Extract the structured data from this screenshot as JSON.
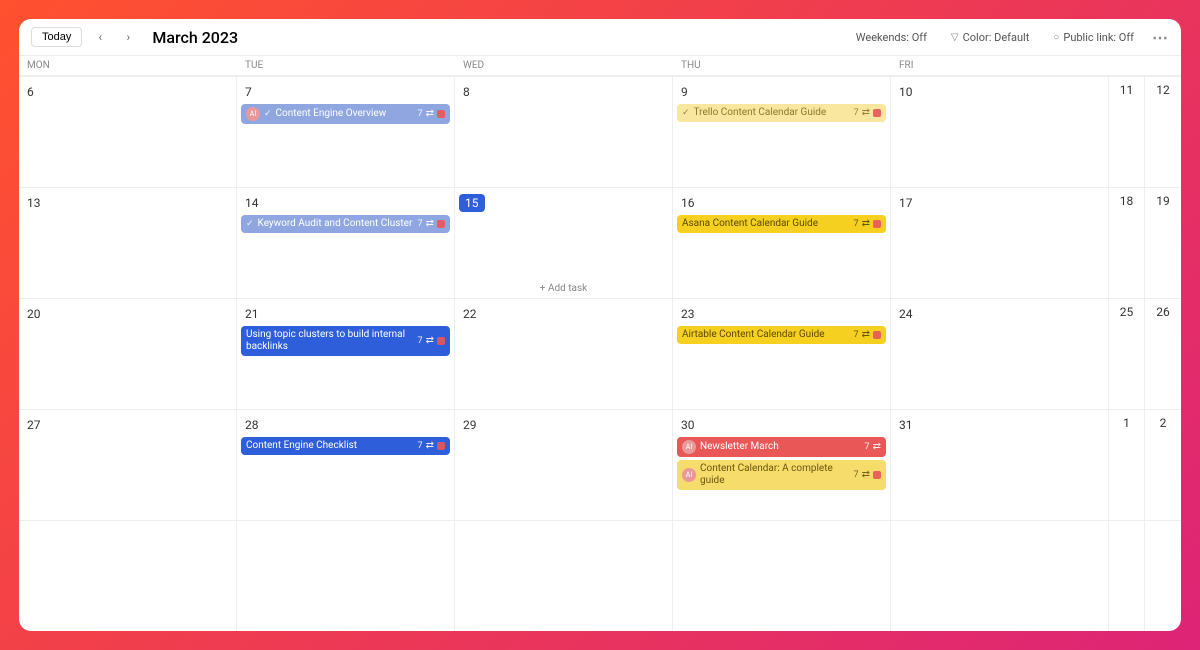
{
  "header": {
    "today": "Today",
    "title": "March 2023",
    "options": {
      "weekends": "Weekends: Off",
      "color": "Color: Default",
      "public": "Public link: Off"
    }
  },
  "days": [
    "MON",
    "TUE",
    "WED",
    "THU",
    "FRI",
    "",
    ""
  ],
  "weeks": [
    {
      "cells": [
        {
          "n": "6"
        },
        {
          "n": "7",
          "tasks": [
            {
              "kind": "light-blue",
              "avatar": "AI",
              "check": true,
              "title": "Content Engine Overview",
              "suffix": "7",
              "loop": true,
              "dot": true
            }
          ]
        },
        {
          "n": "8"
        },
        {
          "n": "9",
          "tasks": [
            {
              "kind": "yellow-faded",
              "check": true,
              "title": "Trello Content Calendar Guide",
              "suffix": "7",
              "loop": true,
              "dot": true
            }
          ]
        },
        {
          "n": "10"
        },
        {
          "n": "11",
          "narrow": true
        },
        {
          "n": "12",
          "narrow": true
        }
      ]
    },
    {
      "cells": [
        {
          "n": "13"
        },
        {
          "n": "14",
          "tasks": [
            {
              "kind": "light-blue",
              "check": true,
              "title": "Keyword Audit and Content Cluster",
              "suffix": "7",
              "loop": true,
              "dot": true
            }
          ]
        },
        {
          "n": "15",
          "today": true,
          "add": true
        },
        {
          "n": "16",
          "tasks": [
            {
              "kind": "yellow",
              "title": "Asana Content Calendar Guide",
              "suffix": "7",
              "loop": true,
              "dot": true
            }
          ]
        },
        {
          "n": "17"
        },
        {
          "n": "18",
          "narrow": true
        },
        {
          "n": "19",
          "narrow": true
        }
      ]
    },
    {
      "cells": [
        {
          "n": "20"
        },
        {
          "n": "21",
          "tasks": [
            {
              "kind": "blue",
              "title": "Using topic clusters to build internal backlinks",
              "wrap": true,
              "suffix": "7",
              "loop": true,
              "dot": true
            }
          ]
        },
        {
          "n": "22"
        },
        {
          "n": "23",
          "tasks": [
            {
              "kind": "yellow",
              "title": "Airtable Content Calendar Guide",
              "suffix": "7",
              "loop": true,
              "dot": true
            }
          ]
        },
        {
          "n": "24"
        },
        {
          "n": "25",
          "narrow": true
        },
        {
          "n": "26",
          "narrow": true
        }
      ]
    },
    {
      "cells": [
        {
          "n": "27"
        },
        {
          "n": "28",
          "tasks": [
            {
              "kind": "blue",
              "title": "Content Engine Checklist",
              "suffix": "7",
              "loop": true,
              "dot": true
            }
          ]
        },
        {
          "n": "29"
        },
        {
          "n": "30",
          "tasks": [
            {
              "kind": "red",
              "avatar": "AI",
              "title": "Newsletter March",
              "suffix": "7",
              "loop": true
            },
            {
              "kind": "yellow-mid",
              "avatar": "AI",
              "title": "Content Calendar: A complete guide",
              "wrap": true,
              "suffix": "7",
              "loop": true,
              "dot": true
            }
          ]
        },
        {
          "n": "31"
        },
        {
          "n": "1",
          "narrow": true
        },
        {
          "n": "2",
          "narrow": true
        }
      ]
    },
    {
      "cells": [
        {
          "n": ""
        },
        {
          "n": ""
        },
        {
          "n": ""
        },
        {
          "n": ""
        },
        {
          "n": ""
        },
        {
          "n": "",
          "narrow": true
        },
        {
          "n": "",
          "narrow": true
        }
      ]
    }
  ],
  "addTaskLabel": "Add task"
}
